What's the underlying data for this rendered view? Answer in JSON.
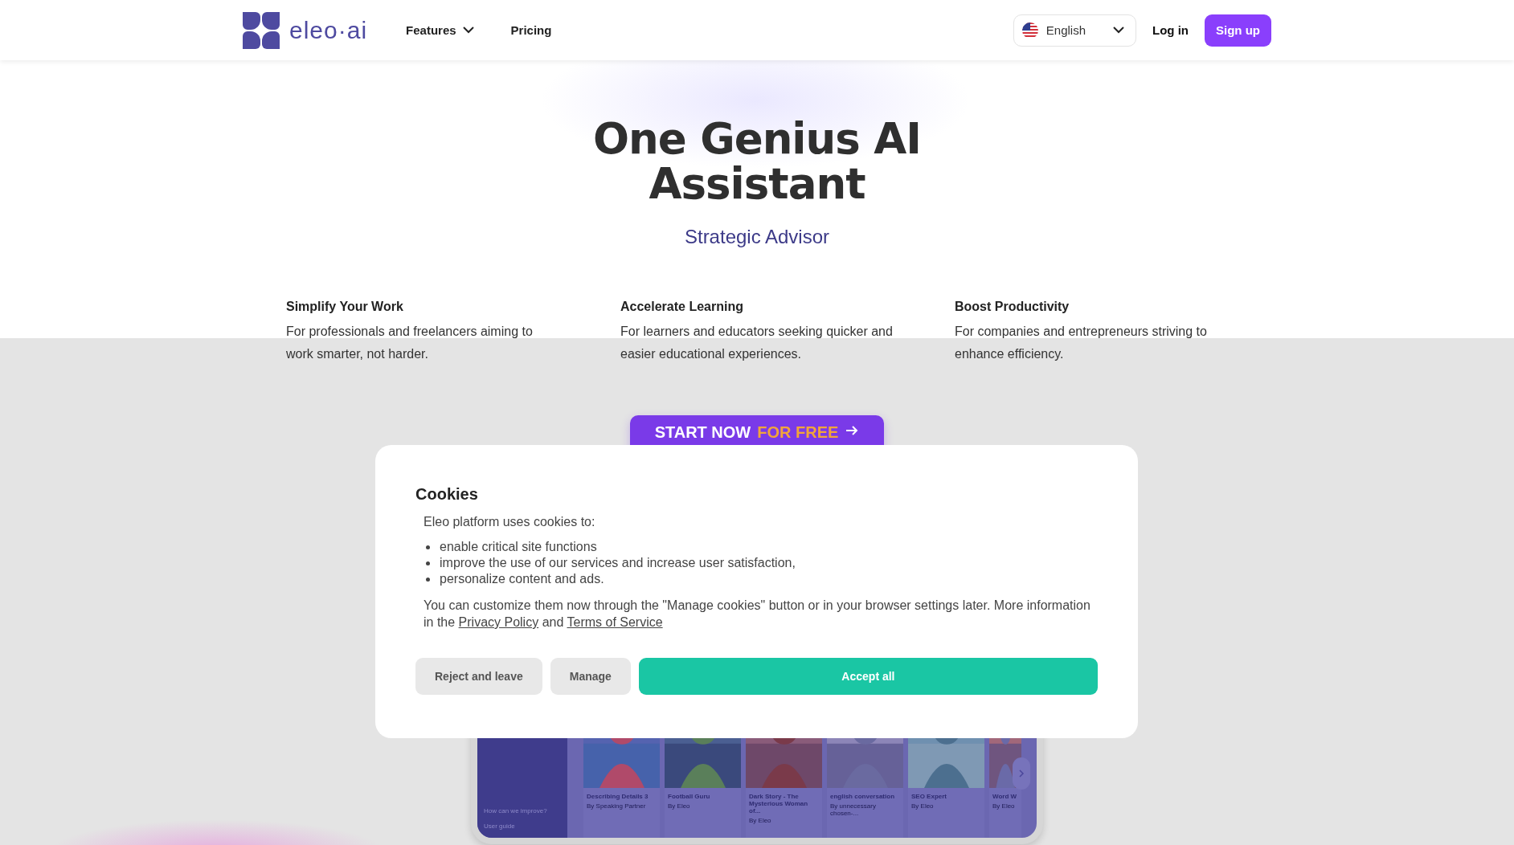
{
  "header": {
    "logo": "eleo·ai",
    "nav": [
      {
        "label": "Features",
        "kind": "dropdown"
      },
      {
        "label": "Pricing",
        "kind": "link"
      }
    ],
    "language": "English",
    "login": "Log in",
    "signup": "Sign up"
  },
  "hero": {
    "title": "One Genius AI Assistant",
    "subtitle": "Strategic Advisor"
  },
  "features": [
    {
      "title": "Simplify Your Work",
      "text": "For professionals and freelancers aiming to work smarter, not harder."
    },
    {
      "title": "Accelerate Learning",
      "text": "For learners and educators seeking quicker and easier educational experiences."
    },
    {
      "title": "Boost Productivity",
      "text": "For companies and entrepreneurs striving to enhance efficiency."
    }
  ],
  "cta": {
    "label": "START NOW",
    "highlight": "FOR FREE"
  },
  "preview": {
    "sidebar": [
      "How can we improve?",
      "User guide"
    ],
    "cards": [
      {
        "title": "Describing Details 3",
        "author": "By Speaking Partner"
      },
      {
        "title": "Football Guru",
        "author": "By Eleo"
      },
      {
        "title": "Dark Story - The Mysterious Woman of...",
        "author": "By Eleo"
      },
      {
        "title": "english conversation",
        "author": "By unnecessary chosen-..."
      },
      {
        "title": "SEO Expert",
        "author": "By Eleo"
      },
      {
        "title": "Word W",
        "author": "By Eleo"
      }
    ]
  },
  "cookies": {
    "title": "Cookies",
    "intro": "Eleo platform uses cookies to:",
    "items": [
      "enable critical site functions",
      "improve the use of our services and increase user satisfaction,",
      "personalize content and ads."
    ],
    "note": "You can customize them now through the \"Manage cookies\" button or in your browser settings later. More information in the",
    "privacy": "Privacy Policy",
    "joiner": "and",
    "terms": "Terms of Service",
    "buttons": [
      {
        "label": "Reject and leave",
        "kind": "secondary"
      },
      {
        "label": "Manage",
        "kind": "secondary"
      },
      {
        "label": "Accept all",
        "kind": "primary"
      }
    ]
  }
}
